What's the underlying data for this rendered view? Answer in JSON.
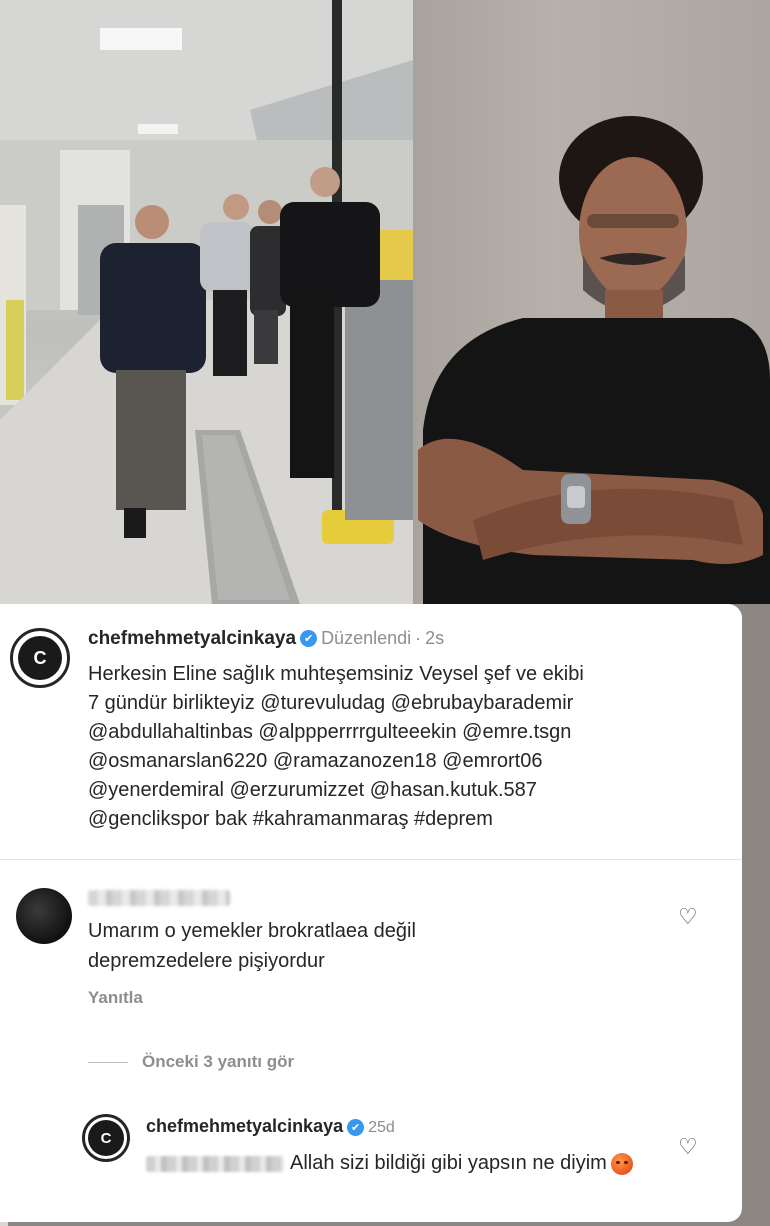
{
  "post": {
    "username": "chefmehmetyalcinkaya",
    "verified_mark": "✔",
    "edited": "Düzenlendi",
    "separator": "·",
    "time": "2s",
    "avatar_letter": "C",
    "caption": "Herkesin Eline sağlık muhteşemsiniz Veysel şef ve ekibi\n7 gündür birlikteyiz @turevuludag @ebrubaybarademir\n@abdullahaltinbas @alppperrrrgulteeekin @emre.tsgn\n@osmanarslan6220 @ramazanozen18 @emrort06\n@yenerdemiral @erzurumizzet  @hasan.kutuk.587\n@genclikspor bak #kahramanmaraş #deprem"
  },
  "comment": {
    "text": "Umarım o yemekler brokratlaea değil\ndepremzedelere pişiyordur",
    "reply_label": "Yanıtla",
    "like_icon": "heart-icon"
  },
  "view_replies": {
    "label": "Önceki 3 yanıtı gör"
  },
  "reply": {
    "username": "chefmehmetyalcinkaya",
    "verified_mark": "✔",
    "time": "25d",
    "avatar_letter": "C",
    "text": "Allah sizi bildiği gibi yapsın ne diyim",
    "emoji_icon": "angry-face-emoji-icon",
    "like_icon": "heart-icon"
  },
  "colors": {
    "text": "#262626",
    "muted": "#8e8e8e",
    "verified": "#3897f0",
    "card_bg": "#ffffff"
  }
}
